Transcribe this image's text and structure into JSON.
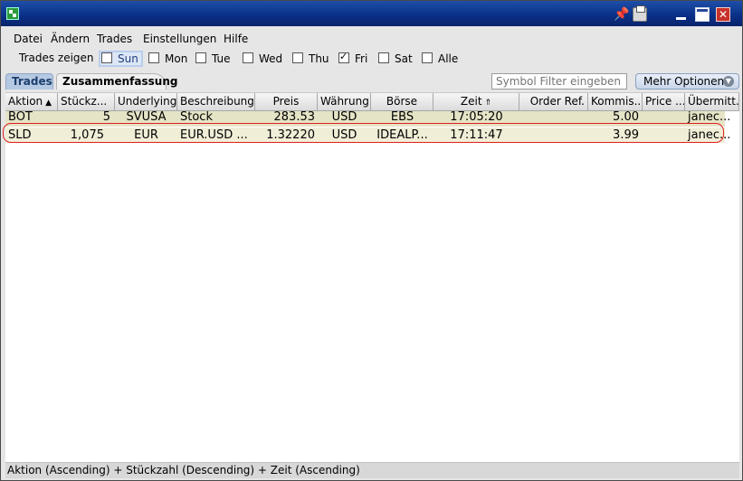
{
  "window": {
    "title": "",
    "titlebar_icons": [
      "app-icon",
      "pin-icon",
      "printer-icon",
      "minimize-icon",
      "maximize-icon",
      "close-icon"
    ]
  },
  "menu": [
    "Datei",
    "Ändern",
    "Trades",
    "Einstellungen",
    "Hilfe"
  ],
  "filter": {
    "label": "Trades zeigen",
    "days": [
      {
        "label": "Sun",
        "checked": false,
        "focused": true
      },
      {
        "label": "Mon",
        "checked": false
      },
      {
        "label": "Tue",
        "checked": false
      },
      {
        "label": "Wed",
        "checked": false
      },
      {
        "label": "Thu",
        "checked": false
      },
      {
        "label": "Fri",
        "checked": true
      },
      {
        "label": "Sat",
        "checked": false
      },
      {
        "label": "Alle",
        "checked": false
      }
    ]
  },
  "tabs": [
    "Trades",
    "Zusammenfassung"
  ],
  "active_tab": "Zusammenfassung",
  "search": {
    "placeholder": "Symbol Filter eingeben"
  },
  "more_options": {
    "label": "Mehr Optionen"
  },
  "table": {
    "columns": [
      "Aktion",
      "Stückz...",
      "Underlying",
      "Beschreibung",
      "Preis",
      "Währung",
      "Börse",
      "Zeit",
      "Order Ref.",
      "Kommis...",
      "Price ...",
      "Übermitt..."
    ],
    "sort_indicators": {
      "Aktion": "▲",
      "Stückz...": "⯯",
      "Zeit": "⇑"
    },
    "rows": [
      [
        "BOT",
        "5",
        "SVUSA",
        "Stock",
        "283.53",
        "USD",
        "EBS",
        "17:05:20",
        "",
        "5.00",
        "",
        "janec..."
      ],
      [
        "SLD",
        "1,075",
        "EUR",
        "EUR.USD ...",
        "1.32220",
        "USD",
        "IDEALP...",
        "17:11:47",
        "",
        "3.99",
        "",
        "janec..."
      ]
    ]
  },
  "status": "Aktion (Ascending)  +  Stückzahl (Descending)  +  Zeit (Ascending)",
  "colors": {
    "titlebar": "#0a246a",
    "highlight": "#e02020",
    "row_bot": "#e6e4c6",
    "row_sld": "#f0eed7"
  }
}
